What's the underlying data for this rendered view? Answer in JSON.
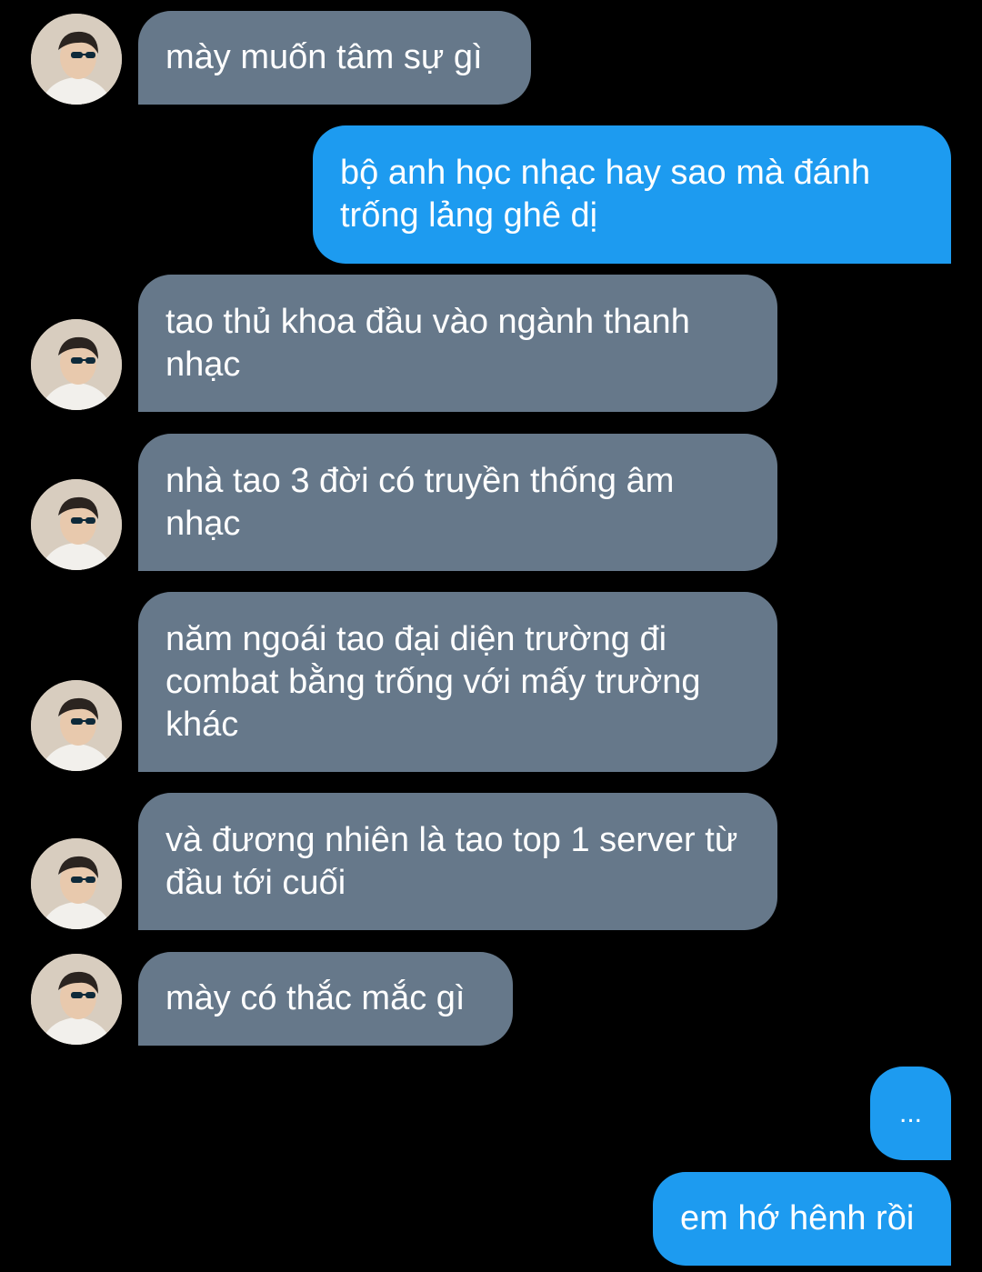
{
  "conversation": {
    "messages": [
      {
        "sender": "them",
        "text": "mày muốn tâm sự gì"
      },
      {
        "sender": "me",
        "text": "bộ anh học nhạc hay sao mà đánh trống lảng ghê dị"
      },
      {
        "sender": "them",
        "text": "tao thủ khoa đầu vào ngành thanh nhạc"
      },
      {
        "sender": "them",
        "text": "nhà tao 3 đời có truyền thống âm nhạc"
      },
      {
        "sender": "them",
        "text": "năm ngoái tao đại diện trường đi combat bằng trống với mấy trường khác"
      },
      {
        "sender": "them",
        "text": "và đương nhiên là tao top 1 server từ đầu tới cuối"
      },
      {
        "sender": "them",
        "text": "mày có thắc mắc gì"
      },
      {
        "sender": "me",
        "text": "..."
      },
      {
        "sender": "me",
        "text": "em hớ hênh rồi"
      }
    ]
  },
  "colors": {
    "background": "#000000",
    "received_bubble": "#66788a",
    "sent_bubble": "#1d9bf0",
    "text": "#ffffff"
  },
  "icons": {
    "avatar": "profile-photo-avatar"
  }
}
